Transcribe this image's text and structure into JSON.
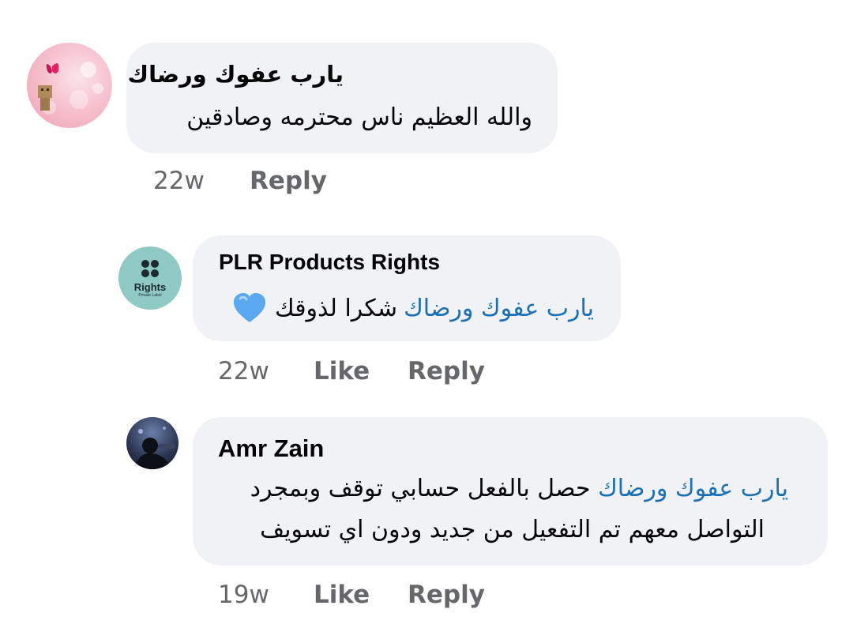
{
  "comments": [
    {
      "author": "يارب عفوك ورضاك",
      "text": "والله العظيم ناس محترمه وصادقين",
      "time": "22w",
      "reply_label": "Reply"
    },
    {
      "author": "PLR Products Rights",
      "avatar_text": "Rights",
      "avatar_subtext": "Private Label",
      "mention": "يارب عفوك ورضاك",
      "text": "شكرا لذوقك",
      "emoji": "💙",
      "time": "22w",
      "like_label": "Like",
      "reply_label": "Reply"
    },
    {
      "author": "Amr Zain",
      "mention": "يارب عفوك ورضاك",
      "text_line1": "حصل بالفعل حسابي توقف وبمجرد",
      "text_line2": "التواصل معهم تم التفعيل من جديد ودون اي تسويف",
      "time": "19w",
      "like_label": "Like",
      "reply_label": "Reply"
    }
  ],
  "colors": {
    "bubble": "#f0f2f5",
    "mention": "#1a6fb5",
    "meta": "#65676b",
    "heart": "#5aa9f0"
  }
}
